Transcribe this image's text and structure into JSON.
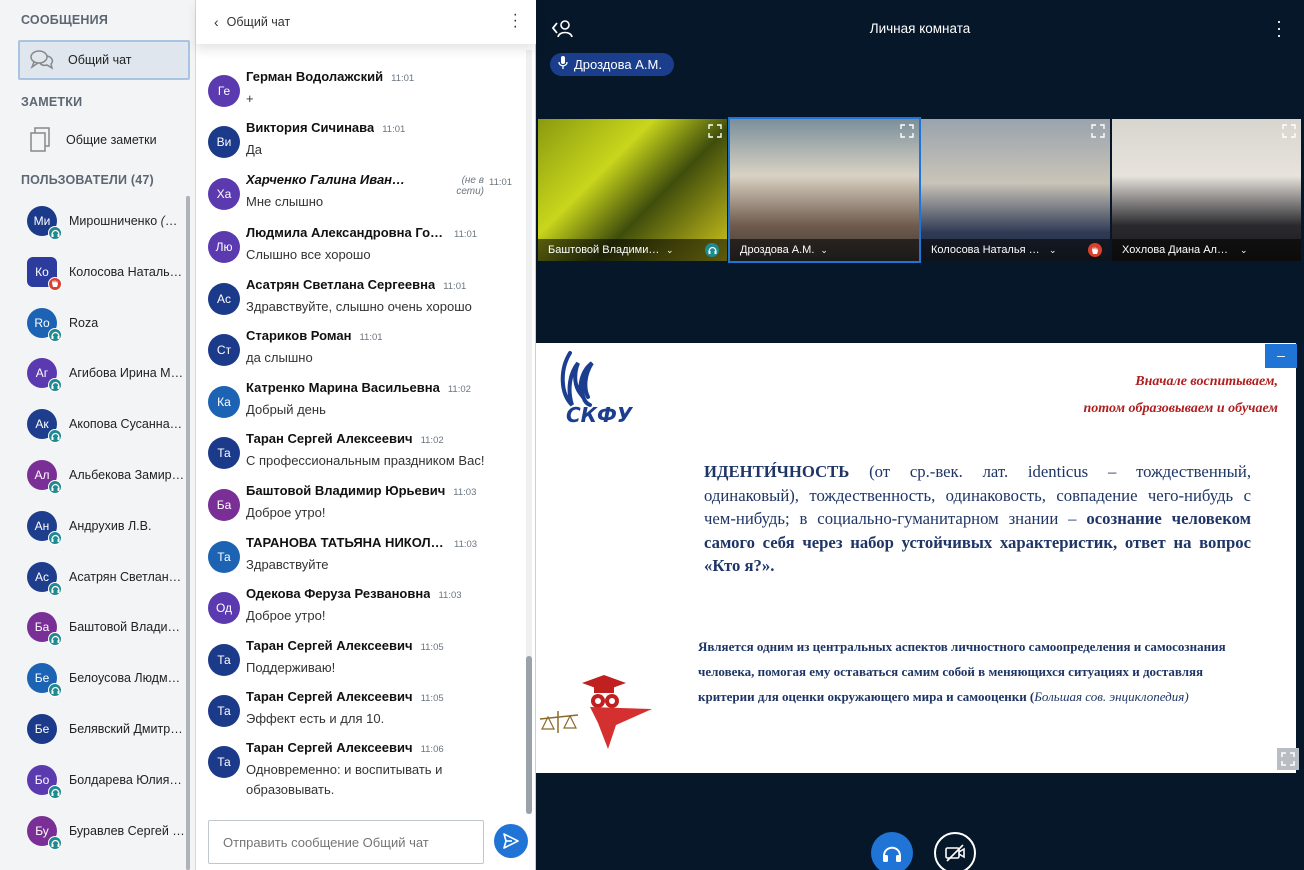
{
  "sidebar": {
    "messages_title": "СООБЩЕНИЯ",
    "public_chat": "Общий чат",
    "notes_title": "ЗАМЕТКИ",
    "shared_notes": "Общие заметки",
    "users_title": "ПОЛЬЗОВАТЕЛИ (47)",
    "users": [
      {
        "initials": "Ми",
        "name": "Мирошниченко",
        "you": "(Вы)",
        "color": "#1c3a8a",
        "status": "audio",
        "shape": "round"
      },
      {
        "initials": "Ко",
        "name": "Колосова Наталья Анатольевна",
        "you": "",
        "color": "#2b3c9e",
        "status": "hand",
        "shape": "square"
      },
      {
        "initials": "Ro",
        "name": "Roza",
        "you": "",
        "color": "#1d63b4",
        "status": "audio",
        "shape": "round"
      },
      {
        "initials": "Аг",
        "name": "Агибова Ирина Михайловна",
        "you": "",
        "color": "#5b3ab0",
        "status": "audio",
        "shape": "round"
      },
      {
        "initials": "Ак",
        "name": "Акопова Сусанна Владимировна",
        "you": "",
        "color": "#1e3d8c",
        "status": "audio",
        "shape": "round"
      },
      {
        "initials": "Ал",
        "name": "Альбекова Замира Юсуповна",
        "you": "",
        "color": "#7a2f97",
        "status": "audio",
        "shape": "round"
      },
      {
        "initials": "Ан",
        "name": "Андрухив Л.В.",
        "you": "",
        "color": "#1e3d8c",
        "status": "audio",
        "shape": "round"
      },
      {
        "initials": "Ас",
        "name": "Асатрян Светлана Сергеевна",
        "you": "",
        "color": "#1e3d8c",
        "status": "audio",
        "shape": "round"
      },
      {
        "initials": "Ба",
        "name": "Баштовой Владимир Юрьевич",
        "you": "",
        "color": "#7a2f97",
        "status": "audio",
        "shape": "round"
      },
      {
        "initials": "Бе",
        "name": "Белоусова Людмила Ивановна",
        "you": "",
        "color": "#1d63b4",
        "status": "audio",
        "shape": "round"
      },
      {
        "initials": "Бе",
        "name": "Белявский Дмитрий Сергеевич",
        "you": "",
        "color": "#1c3a8a",
        "status": "none",
        "shape": "round"
      },
      {
        "initials": "Бо",
        "name": "Болдарева Юлия Александровна",
        "you": "",
        "color": "#5b3ab0",
        "status": "audio",
        "shape": "round"
      },
      {
        "initials": "Бу",
        "name": "Буравлев Сергей Николаевич",
        "you": "",
        "color": "#7a2f97",
        "status": "audio",
        "shape": "round"
      }
    ]
  },
  "chat": {
    "title": "Общий чат",
    "input_placeholder": "Отправить сообщение Общий чат",
    "messages": [
      {
        "initials": "Ге",
        "author": "Герман Водолажский",
        "time": "11:01",
        "text": "+",
        "color": "#5b3ab0",
        "offline": ""
      },
      {
        "initials": "Ви",
        "author": "Виктория Сичинава",
        "time": "11:01",
        "text": "Да",
        "color": "#1c3a8a",
        "offline": ""
      },
      {
        "initials": "Ха",
        "author": "Харченко Галина Ивановна",
        "time": "11:01",
        "text": "Мне слышно",
        "color": "#5b3ab0",
        "offline": "(не в сети)"
      },
      {
        "initials": "Лю",
        "author": "Людмила Александровна Горбунова",
        "time": "11:01",
        "text": "Слышно все хорошо",
        "color": "#5b3ab0",
        "offline": ""
      },
      {
        "initials": "Ас",
        "author": "Асатрян Светлана Сергеевна",
        "time": "11:01",
        "text": "Здравствуйте, слышно очень хорошо",
        "color": "#1c3a8a",
        "offline": ""
      },
      {
        "initials": "Ст",
        "author": "Стариков Роман",
        "time": "11:01",
        "text": "да слышно",
        "color": "#1c3a8a",
        "offline": ""
      },
      {
        "initials": "Ка",
        "author": "Катренко Марина Васильевна",
        "time": "11:02",
        "text": "Добрый день",
        "color": "#1d63b4",
        "offline": ""
      },
      {
        "initials": "Та",
        "author": "Таран Сергей Алексеевич",
        "time": "11:02",
        "text": "С профессиональным праздником Вас!",
        "color": "#1c3a8a",
        "offline": ""
      },
      {
        "initials": "Ба",
        "author": "Баштовой Владимир Юрьевич",
        "time": "11:03",
        "text": "Доброе утро!",
        "color": "#7a2f97",
        "offline": ""
      },
      {
        "initials": "Та",
        "author": "ТАРАНОВА ТАТЬЯНА НИКОЛАЕВНА",
        "time": "11:03",
        "text": "Здравствуйте",
        "color": "#1d63b4",
        "offline": ""
      },
      {
        "initials": "Од",
        "author": "Одекова Феруза Резвановна",
        "time": "11:03",
        "text": "Доброе утро!",
        "color": "#5b3ab0",
        "offline": ""
      },
      {
        "initials": "Та",
        "author": "Таран Сергей Алексеевич",
        "time": "11:05",
        "text": "Поддерживаю!",
        "color": "#1c3a8a",
        "offline": ""
      },
      {
        "initials": "Та",
        "author": "Таран Сергей Алексеевич",
        "time": "11:05",
        "text": "Эффект есть и для 10.",
        "color": "#1c3a8a",
        "offline": ""
      },
      {
        "initials": "Та",
        "author": "Таран Сергей Алексеевич",
        "time": "11:06",
        "text": "Одновременно: и воспитывать и образовывать.",
        "color": "#1c3a8a",
        "offline": ""
      }
    ]
  },
  "main": {
    "room_title": "Личная комната",
    "presenter": "Дроздова А.М.",
    "tiles": [
      {
        "name": "Баштовой Владимир Юрьевич",
        "status": "audio",
        "bg": "linear-gradient(135deg,#8a9a10 0%,#c9d61c 35%,#3f4d0c 60%,#d2c71c 100%)"
      },
      {
        "name": "Дроздова А.М.",
        "status": "none",
        "bg": "linear-gradient(180deg,#7a8f9a 0%,#d9d2c4 40%,#6f5b4d 75%,#3e3a3a 100%)"
      },
      {
        "name": "Колосова Наталья Анатольевна",
        "status": "hand",
        "bg": "linear-gradient(180deg,#9aa3ad 0%,#c9c4b8 45%,#2f3a55 80%,#222a3b 100%)"
      },
      {
        "name": "Хохлова Диана Александровна",
        "status": "none",
        "bg": "linear-gradient(180deg,#d8d5cf 0%,#e7e3dc 40%,#2a2a2e 75%,#1b1b1d 100%)"
      }
    ],
    "slide": {
      "logo": "СКФУ",
      "motto_1": "Вначале воспитываем,",
      "motto_2": "потом образовываем и обучаем",
      "term": "ИДЕНТИ́ЧНОСТЬ",
      "def_plain": " (от ср.-век. лат. identicus – тождественный, одинаковый), тождественность, одинаковость, совпадение чего-нибудь с чем-нибудь; в социально-гуманитарном знании – ",
      "def_bold": "осознание человеком самого себя через набор устойчивых характеристик, ответ на вопрос «Кто я?».",
      "desc": "Является одним из центральных аспектов личностного самоопределения и самосознания человека, помогая ему оставаться самим собой в меняющихся ситуациях и доставляя критерии для оценки окружающего мира и самооценки (",
      "desc_source": "Большая сов. энциклопедия",
      "desc_end": ")"
    }
  }
}
